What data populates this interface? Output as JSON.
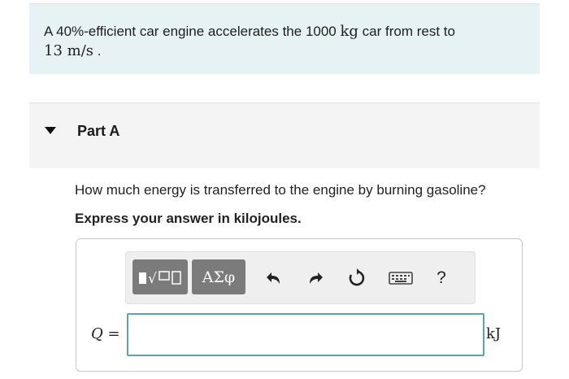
{
  "problem": {
    "line1_pre": "A 40%-efficient car engine accelerates the 1000 ",
    "line1_unit": "kg",
    "line1_post": " car from rest to",
    "line2_value": "13 ",
    "line2_unit": "m/s",
    "line2_post": " ."
  },
  "part": {
    "label": "Part A",
    "question": "How much energy is transferred to the engine by burning gasoline?",
    "instruction": "Express your answer in kilojoules."
  },
  "toolbar": {
    "symbols_label": "ΑΣφ",
    "help_label": "?",
    "icons": [
      "templates-icon",
      "undo-icon",
      "redo-icon",
      "reset-icon",
      "keyboard-icon",
      "help-icon"
    ]
  },
  "answer": {
    "variable": "Q",
    "equals": " =",
    "value": "",
    "unit": "kJ"
  },
  "colors": {
    "problem_bg": "#e6f2f4",
    "part_bg": "#f4f4f4",
    "toolbar_button": "#7b7b7b",
    "input_border": "#5ba3ab"
  }
}
